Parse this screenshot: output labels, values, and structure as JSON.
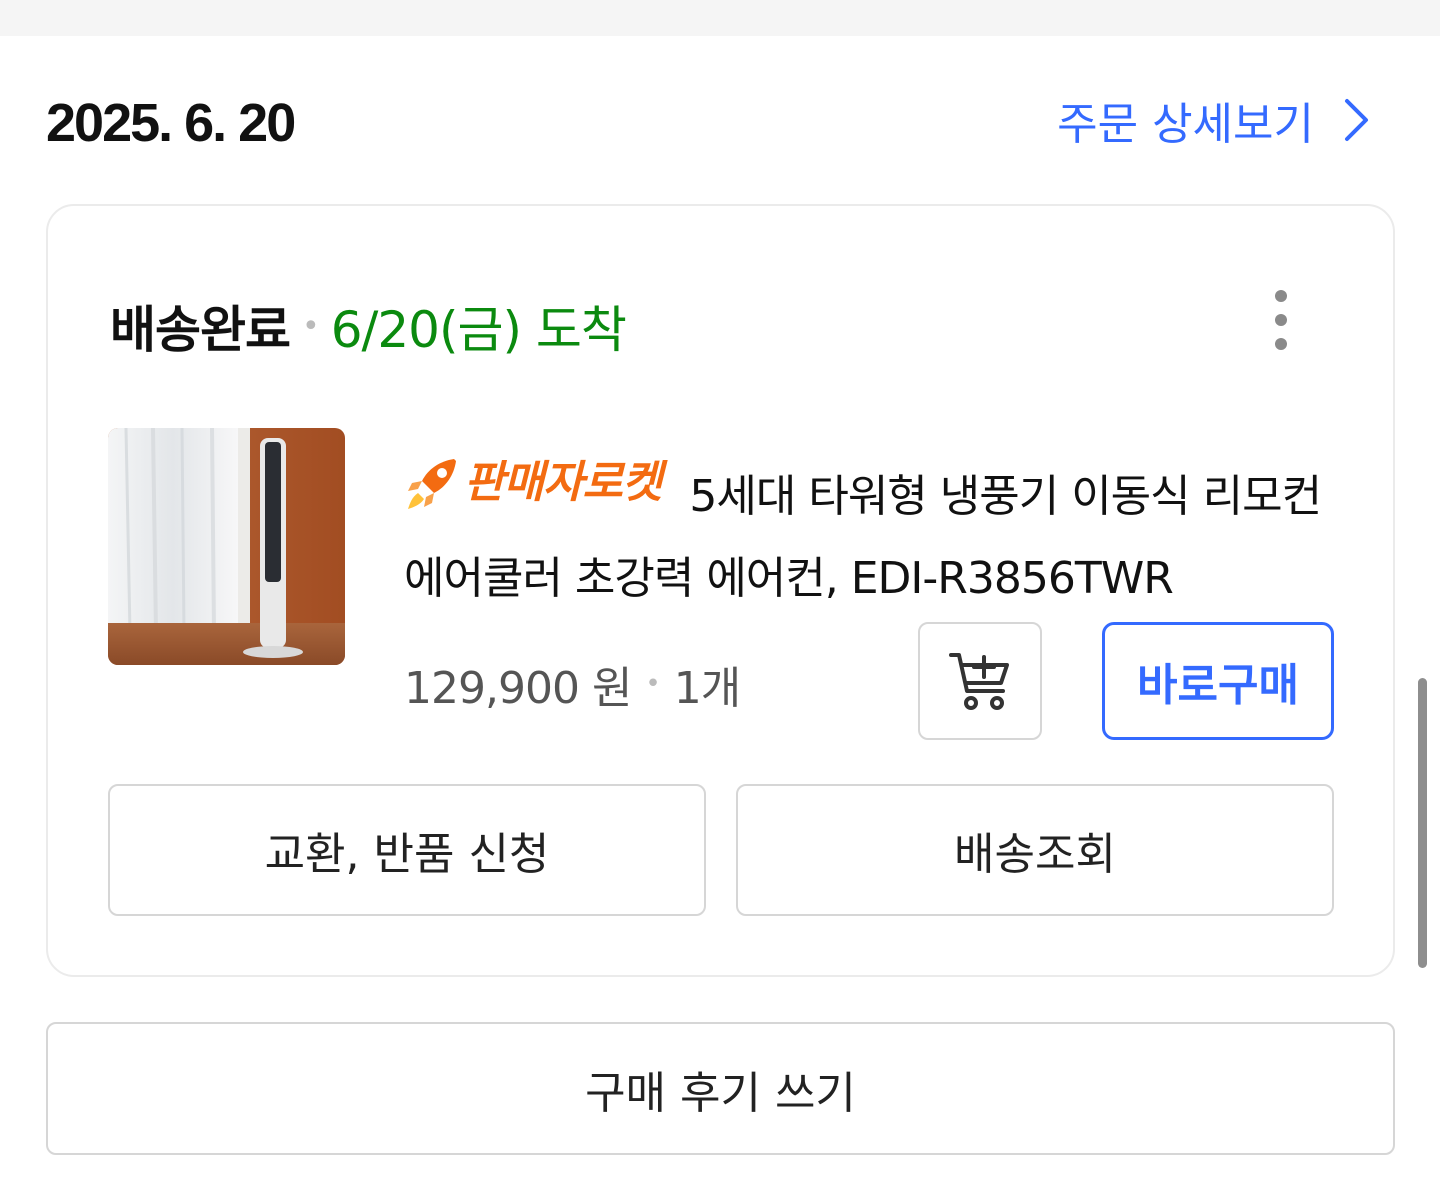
{
  "order": {
    "date": "2025. 6. 20",
    "detail_link_label": "주문 상세보기",
    "status_label": "배송완료",
    "arrival_text": "6/20(금) 도착",
    "colors": {
      "accent": "#346aff",
      "arrival_green": "#0b8a0f",
      "rocket_orange": "#f36b11"
    }
  },
  "product": {
    "badge": "판매자로켓",
    "badge_icon": "rocket-icon",
    "title": "5세대 타워형 냉풍기 이동식 리모컨 에어쿨러 초강력 에어컨, EDI-R3856TWR",
    "price": "129,900 원",
    "quantity": "1개",
    "image_alt": "tower-fan-product-image"
  },
  "actions": {
    "cart_icon": "cart-add-icon",
    "buy_now_label": "바로구매",
    "return_label": "교환, 반품 신청",
    "track_label": "배송조회",
    "review_label": "구매 후기 쓰기"
  },
  "icons": {
    "more": "more-vertical-icon",
    "chevron": "chevron-right-icon"
  }
}
